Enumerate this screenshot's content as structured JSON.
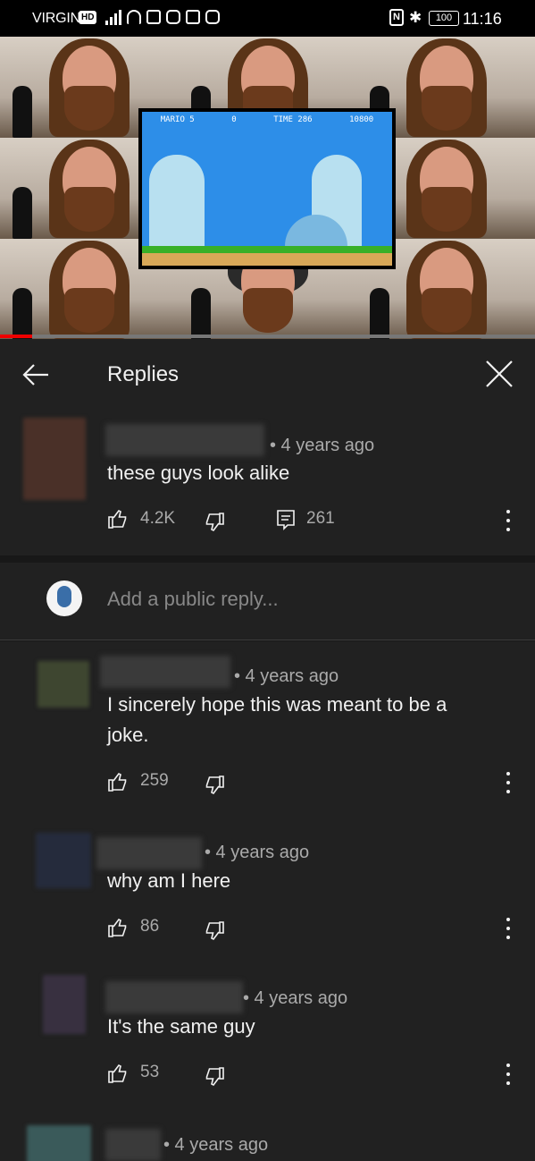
{
  "status_bar": {
    "carrier": "VIRGIN",
    "hd_badge": "HD",
    "battery": "100",
    "time": "11:16"
  },
  "video": {
    "progress": 0.06,
    "game_hud": [
      "MARIO 5",
      "0",
      "TIME 286",
      "10800"
    ]
  },
  "header": {
    "title": "Replies"
  },
  "parent_comment": {
    "meta": "• 4 years ago",
    "text": "these guys look alike",
    "likes": "4.2K",
    "replies": "261"
  },
  "reply_input": {
    "placeholder": "Add a public reply..."
  },
  "replies": [
    {
      "meta": "• 4 years ago",
      "text": "I sincerely hope this was meant to be a joke.",
      "likes": "259"
    },
    {
      "meta": "• 4 years ago",
      "text": "why am I here",
      "likes": "86"
    },
    {
      "meta": "• 4 years ago",
      "text": "It's the same guy",
      "likes": "53"
    },
    {
      "meta": "• 4 years ago",
      "text": "",
      "likes": ""
    }
  ],
  "colors": {
    "background": "#181818",
    "panel": "#212121",
    "text": "#f1f1f1",
    "muted": "#aaaaaa",
    "progress": "#ee0000"
  }
}
